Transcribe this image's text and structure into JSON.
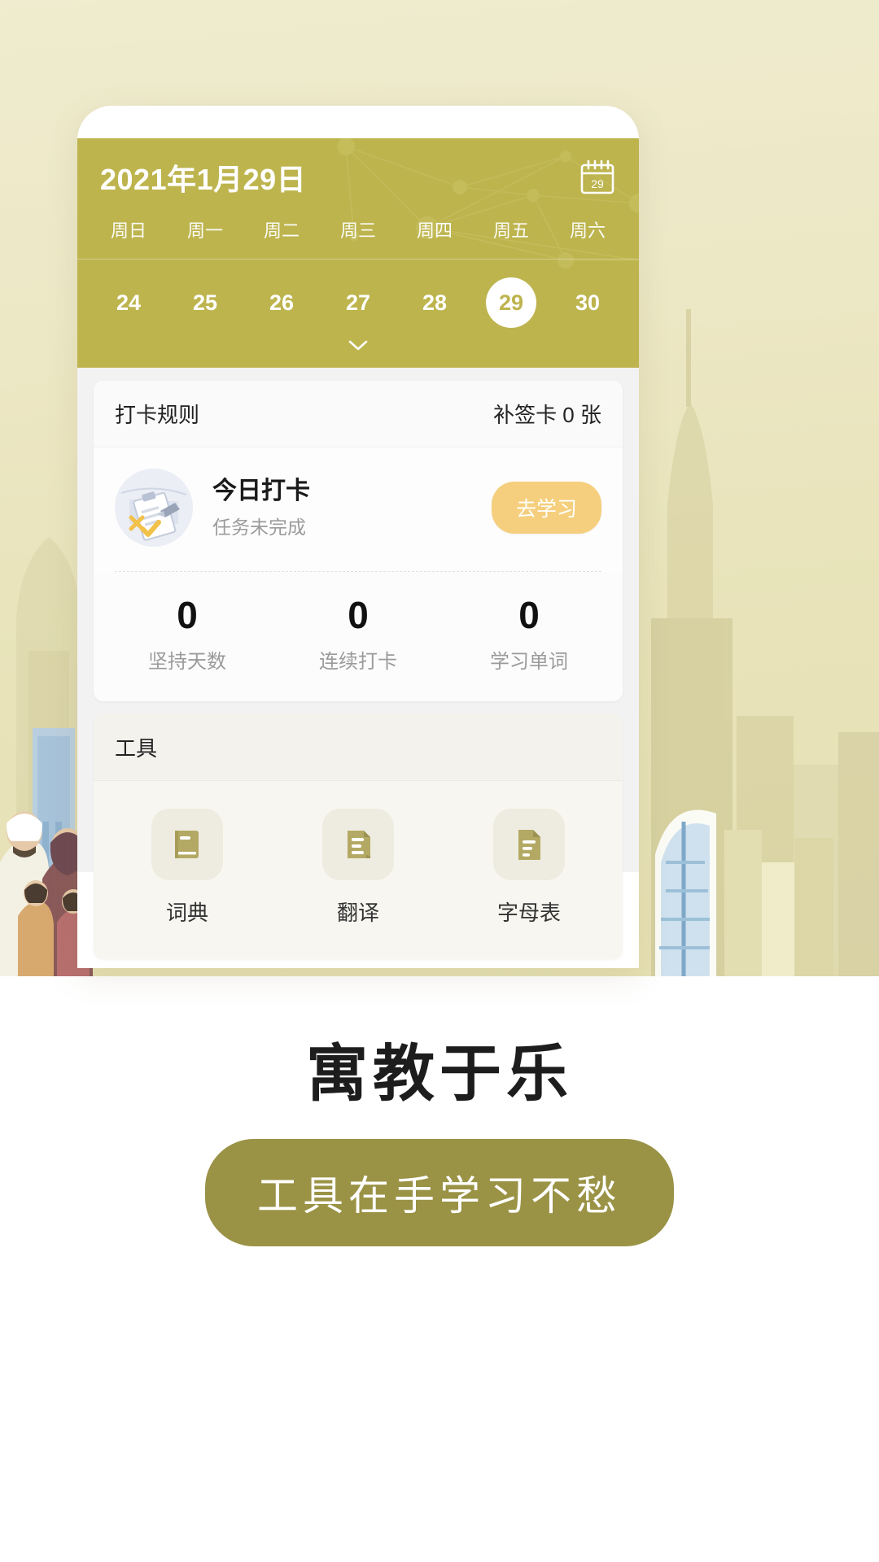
{
  "app": {
    "calendar": {
      "title": "2021年1月29日",
      "calendar_icon_label": "29",
      "weekdays": [
        "周日",
        "周一",
        "周二",
        "周三",
        "周四",
        "周五",
        "周六"
      ],
      "days": [
        "24",
        "25",
        "26",
        "27",
        "28",
        "29",
        "30"
      ],
      "selected_day": "29",
      "expand_icon": "chevron-down-icon"
    },
    "checkin_card": {
      "rules_label": "打卡规则",
      "makeup_cards_label": "补签卡 0 张",
      "title": "今日打卡",
      "subtitle": "任务未完成",
      "action_button": "去学习",
      "stats": [
        {
          "value": "0",
          "label": "坚持天数"
        },
        {
          "value": "0",
          "label": "连续打卡"
        },
        {
          "value": "0",
          "label": "学习单词"
        }
      ]
    },
    "tools_card": {
      "header": "工具",
      "items": [
        {
          "label": "词典",
          "icon": "book-icon"
        },
        {
          "label": "翻译",
          "icon": "document-lines-icon"
        },
        {
          "label": "字母表",
          "icon": "file-text-icon"
        }
      ]
    }
  },
  "promo": {
    "headline": "寓教于乐",
    "pill": "工具在手学习不愁"
  },
  "colors": {
    "header_olive": "#bdb44e",
    "accent_amber": "#f5cf7d",
    "pill_olive": "#9a9245",
    "tool_icon": "#b3a964",
    "background_cream": "#ece7c4"
  }
}
